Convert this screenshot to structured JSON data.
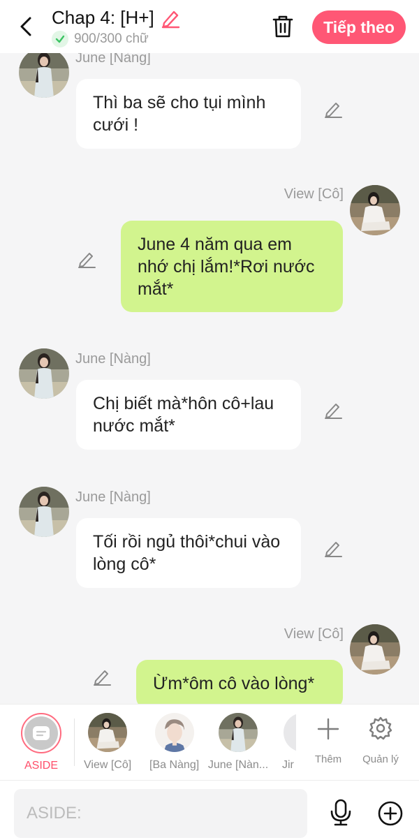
{
  "header": {
    "title": "Chap 4: [H+]",
    "word_count": "900/300 chữ",
    "next_label": "Tiếp theo"
  },
  "messages": [
    {
      "speaker": "June [Nàng]",
      "side": "left",
      "text": "Thì ba sẽ cho tụi mình cưới !"
    },
    {
      "speaker": "View [Cô]",
      "side": "right",
      "text": "June 4 năm qua em nhớ chị lắm!*Rơi nước mắt*"
    },
    {
      "speaker": "June [Nàng]",
      "side": "left",
      "text": "Chị biết mà*hôn cô+lau nước mắt*"
    },
    {
      "speaker": "June [Nàng]",
      "side": "left",
      "text": "Tối rồi ngủ thôi*chui vào lòng cô*"
    },
    {
      "speaker": "View [Cô]",
      "side": "right",
      "text": "Ừm*ôm cô vào lòng*"
    }
  ],
  "characters": [
    {
      "label": "ASIDE",
      "selected": true
    },
    {
      "label": "View [Cô]"
    },
    {
      "label": "[Ba Nàng]"
    },
    {
      "label": "June [Nàn..."
    },
    {
      "label": "Jir"
    }
  ],
  "toolbar": {
    "add_label": "Thêm",
    "manage_label": "Quản lý"
  },
  "composer": {
    "placeholder": "ASIDE:"
  },
  "colors": {
    "accent": "#ff5775",
    "bubble_right": "#d2f48e",
    "bubble_left": "#ffffff",
    "check_green": "#3cc463"
  }
}
